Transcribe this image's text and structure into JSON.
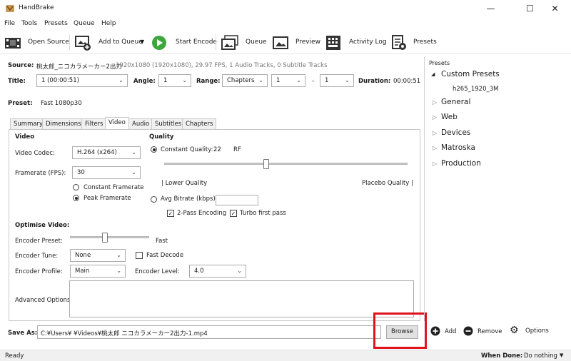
{
  "window": {
    "title": "HandBrake",
    "minimize": "—",
    "maximize": "☐",
    "close": "✕"
  },
  "menu": [
    "File",
    "Tools",
    "Presets",
    "Queue",
    "Help"
  ],
  "toolbar": {
    "open_source": "Open Source",
    "add_to_queue": "Add to Queue",
    "start_encode": "Start Encode",
    "queue": "Queue",
    "preview": "Preview",
    "activity_log": "Activity Log",
    "presets": "Presets"
  },
  "source": {
    "label": "Source:",
    "name": "桃太郎_ニコカラメーカー2出力",
    "info": "1920x1080 (1920x1080), 29.97 FPS, 1 Audio Tracks, 0 Subtitle Tracks"
  },
  "title_row": {
    "title_label": "Title:",
    "title_value": "1 (00:00:51)",
    "angle_label": "Angle:",
    "angle_value": "1",
    "range_label": "Range:",
    "range_value": "Chapters",
    "range_start": "1",
    "range_dash": "-",
    "range_end": "1",
    "duration_label": "Duration:",
    "duration_value": "00:00:51"
  },
  "preset": {
    "label": "Preset:",
    "value": "Fast 1080p30"
  },
  "tabs": [
    "Summary",
    "Dimensions",
    "Filters",
    "Video",
    "Audio",
    "Subtitles",
    "Chapters"
  ],
  "video": {
    "heading": "Video",
    "codec_label": "Video Codec:",
    "codec_value": "H.264 (x264)",
    "framerate_label": "Framerate (FPS):",
    "framerate_value": "30",
    "constant_framerate": "Constant Framerate",
    "peak_framerate": "Peak Framerate"
  },
  "quality": {
    "heading": "Quality",
    "constant_quality": "Constant Quality:",
    "cq_value": "22",
    "cq_unit": "RF",
    "cq_level": 0.42,
    "lower_quality": "| Lower Quality",
    "placebo_quality": "Placebo Quality |",
    "avg_bitrate": "Avg Bitrate (kbps):",
    "two_pass": "2-Pass Encoding",
    "turbo": "Turbo first pass"
  },
  "optimise": {
    "heading": "Optimise Video:",
    "preset_label": "Encoder Preset:",
    "preset_value": "Fast",
    "tune_label": "Encoder Tune:",
    "tune_value": "None",
    "fast_decode": "Fast Decode",
    "profile_label": "Encoder Profile:",
    "profile_value": "Main",
    "level_label": "Encoder Level:",
    "level_value": "4.0",
    "advanced_label": "Advanced Options:"
  },
  "save_as": {
    "label": "Save As:",
    "path": "C:¥Users¥                    ¥Videos¥桃太郎 ニコカラメーカー2出力-1.mp4",
    "browse": "Browse"
  },
  "presets_panel": {
    "heading": "Presets",
    "items": [
      "Custom Presets",
      "h265_1920_3M",
      "General",
      "Web",
      "Devices",
      "Matroska",
      "Production"
    ],
    "add": "Add",
    "remove": "Remove",
    "options": "Options"
  },
  "status": {
    "ready": "Ready",
    "when_done_label": "When Done:",
    "when_done_value": "Do nothing"
  },
  "colors": {
    "highlight": "#e0141c",
    "accent": "#0078d7",
    "play_green": "#3ea63e"
  }
}
